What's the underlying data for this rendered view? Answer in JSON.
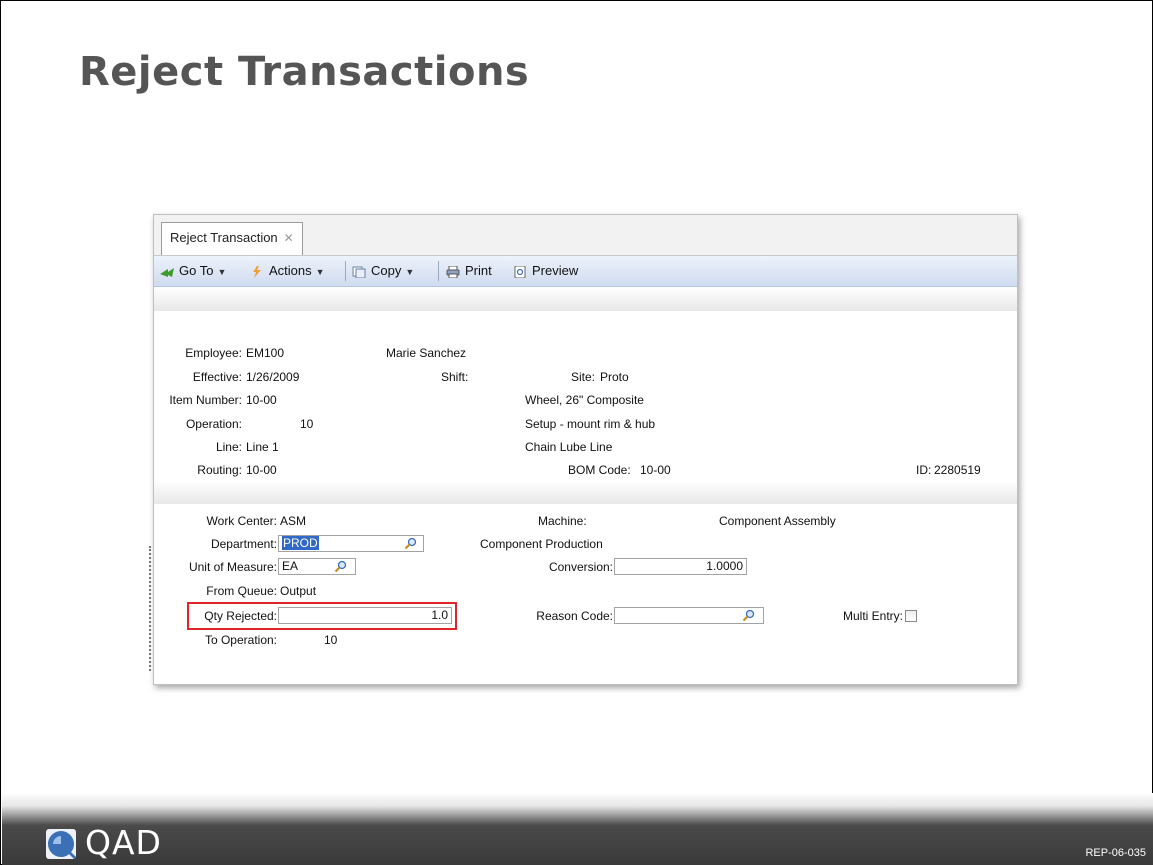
{
  "slide": {
    "title": "Reject Transactions",
    "code": "REP-06-035",
    "logo_text": "QAD"
  },
  "window": {
    "tab_label": "Reject Transaction",
    "toolbar": {
      "goto": "Go To",
      "actions": "Actions",
      "copy": "Copy",
      "print": "Print",
      "preview": "Preview"
    }
  },
  "header": {
    "employee_label": "Employee:",
    "employee_value": "EM100",
    "employee_name": "Marie Sanchez",
    "effective_label": "Effective:",
    "effective_value": "1/26/2009",
    "shift_label": "Shift:",
    "site_label": "Site:",
    "site_value": "Proto",
    "item_label": "Item Number:",
    "item_value": "10-00",
    "item_desc": "Wheel, 26\" Composite",
    "operation_label": "Operation:",
    "operation_value": "10",
    "operation_desc": "Setup - mount rim & hub",
    "line_label": "Line:",
    "line_value": "Line 1",
    "line_desc": "Chain Lube Line",
    "routing_label": "Routing:",
    "routing_value": "10-00",
    "bom_label": "BOM Code:",
    "bom_value": "10-00",
    "id_label": "ID:",
    "id_value": "2280519"
  },
  "detail": {
    "workcenter_label": "Work Center:",
    "workcenter_value": "ASM",
    "machine_label": "Machine:",
    "machine_desc": "Component Assembly",
    "department_label": "Department:",
    "department_value": "PROD",
    "department_desc": "Component Production",
    "uom_label": "Unit of Measure:",
    "uom_value": "EA",
    "conversion_label": "Conversion:",
    "conversion_value": "1.0000",
    "fromqueue_label": "From Queue:",
    "fromqueue_value": "Output",
    "qty_label": "Qty Rejected:",
    "qty_value": "1.0",
    "reason_label": "Reason Code:",
    "reason_value": "",
    "multientry_label": "Multi Entry:",
    "multientry_checked": false,
    "tooperation_label": "To Operation:",
    "tooperation_value": "10"
  },
  "colors": {
    "highlight": "#e0242c",
    "selection": "#3169c6",
    "title": "#555555"
  }
}
